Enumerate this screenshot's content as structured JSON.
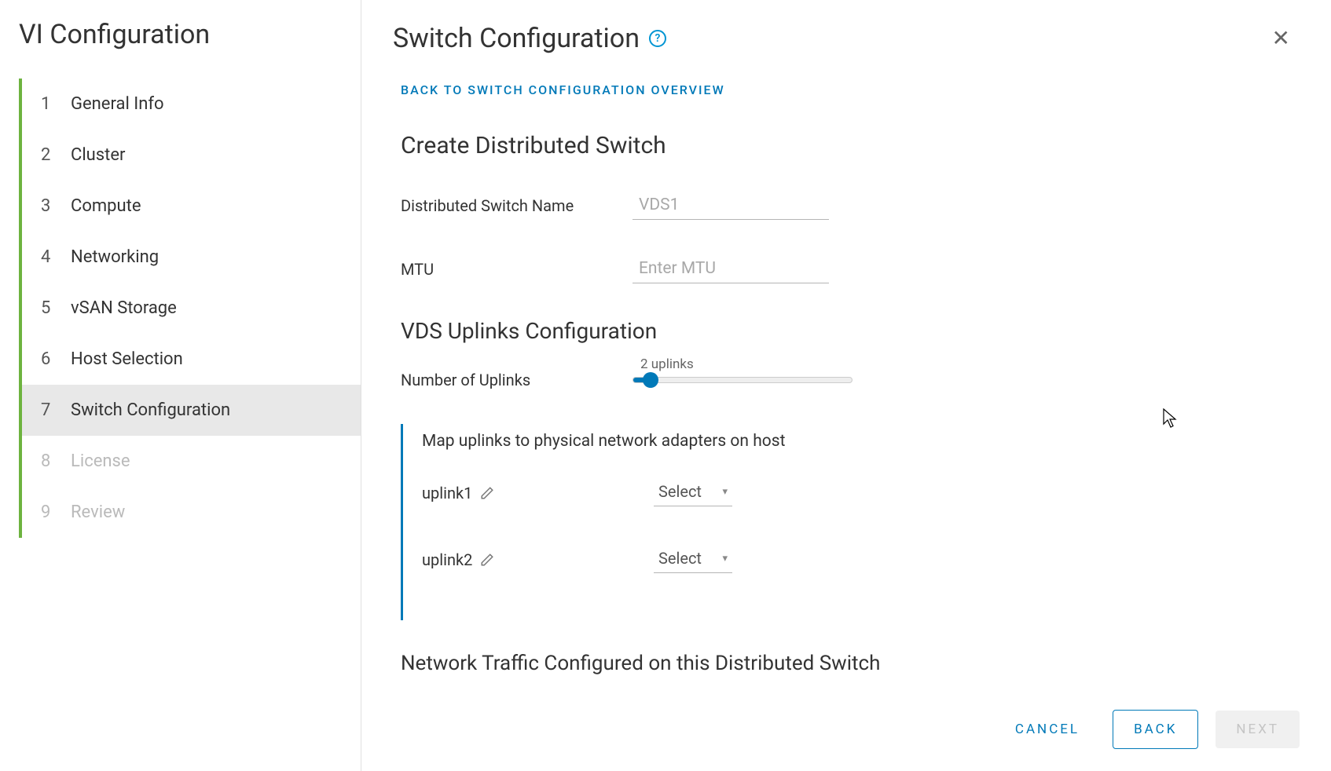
{
  "sidebar": {
    "title": "VI Configuration",
    "steps": [
      {
        "num": "1",
        "label": "General Info"
      },
      {
        "num": "2",
        "label": "Cluster"
      },
      {
        "num": "3",
        "label": "Compute"
      },
      {
        "num": "4",
        "label": "Networking"
      },
      {
        "num": "5",
        "label": "vSAN Storage"
      },
      {
        "num": "6",
        "label": "Host Selection"
      },
      {
        "num": "7",
        "label": "Switch Configuration"
      },
      {
        "num": "8",
        "label": "License"
      },
      {
        "num": "9",
        "label": "Review"
      }
    ],
    "activeIndex": 6
  },
  "header": {
    "title": "Switch Configuration",
    "close": "✕"
  },
  "body": {
    "backLink": "BACK TO SWITCH CONFIGURATION OVERVIEW",
    "createTitle": "Create Distributed Switch",
    "switchNameLabel": "Distributed Switch Name",
    "switchNamePlaceholder": "VDS1",
    "mtuLabel": "MTU",
    "mtuPlaceholder": "Enter MTU",
    "uplinksTitle": "VDS Uplinks Configuration",
    "uplinksCountLabel": "Number of Uplinks",
    "uplinksCountCaption": "2 uplinks",
    "mapHint": "Map uplinks to physical network adapters on host",
    "uplinks": [
      {
        "name": "uplink1",
        "select": "Select"
      },
      {
        "name": "uplink2",
        "select": "Select"
      }
    ],
    "trafficTitle": "Network Traffic Configured on this Distributed Switch"
  },
  "footer": {
    "cancel": "CANCEL",
    "back": "BACK",
    "next": "NEXT"
  }
}
